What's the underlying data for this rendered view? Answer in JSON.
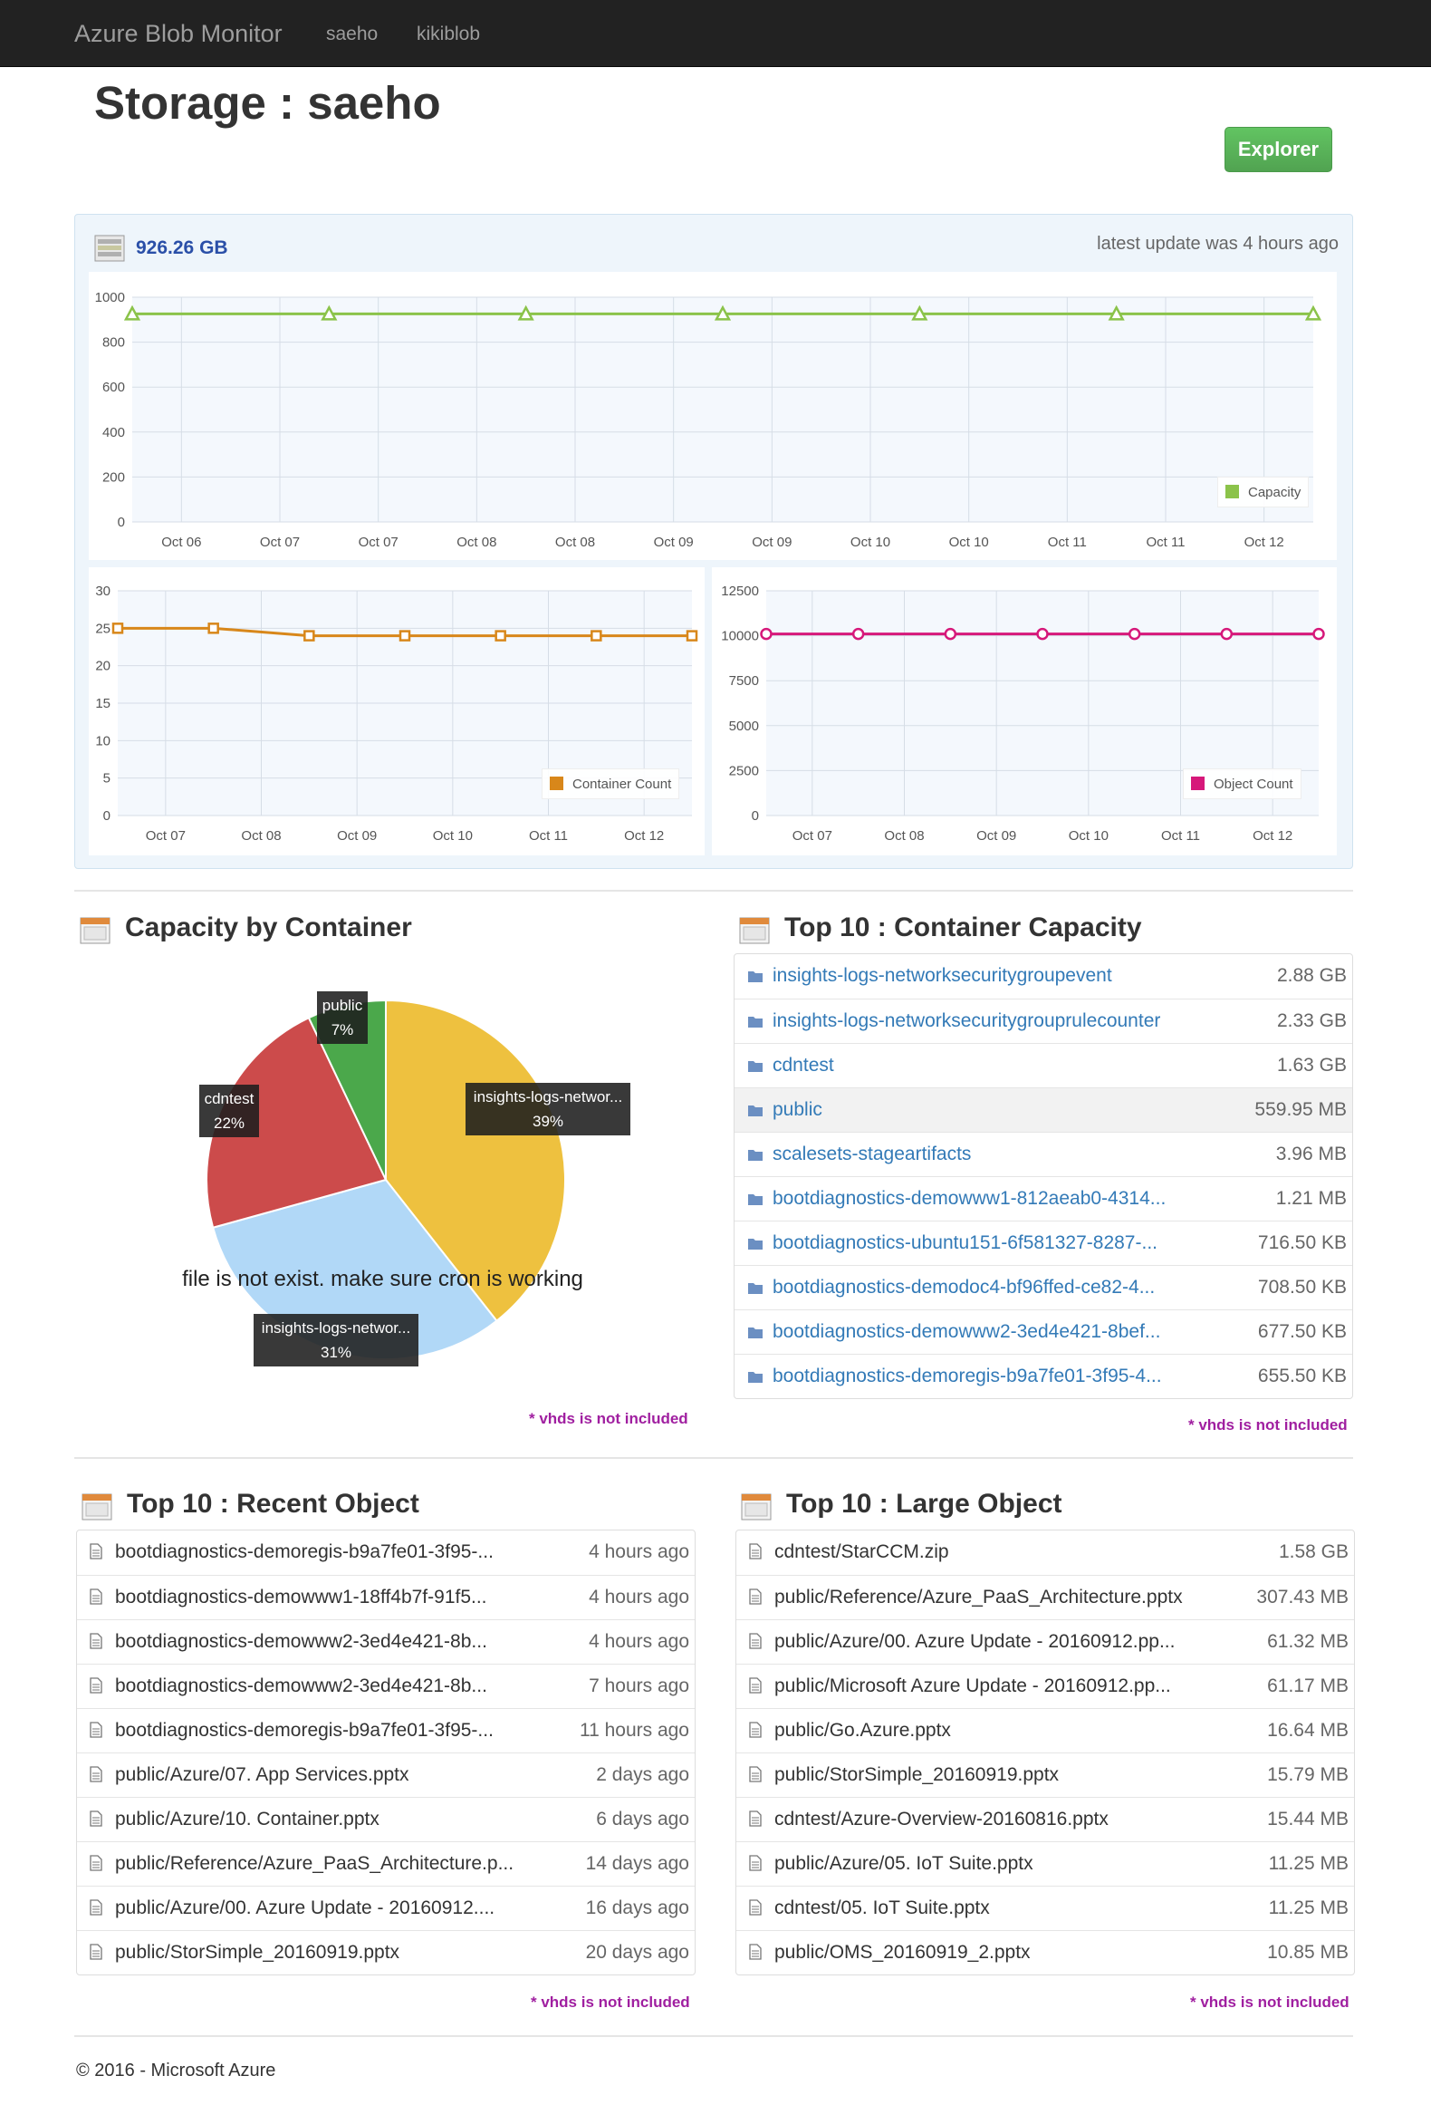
{
  "nav": {
    "brand": "Azure Blob Monitor",
    "links": [
      "saeho",
      "kikiblob"
    ]
  },
  "page": {
    "title": "Storage : saeho",
    "explorer_label": "Explorer"
  },
  "stats": {
    "capacity_value": "926.26 GB",
    "last_update": "latest update was 4 hours ago"
  },
  "colors": {
    "capacity": "#8bc34a",
    "container_count": "#d8871a",
    "object_count": "#d6187a",
    "pie_insights1": "#eec13f",
    "pie_insights2": "#b1d8f7",
    "pie_cdntest": "#cc4b4b",
    "pie_public": "#4ba84b",
    "link": "#337ab7",
    "note": "#a01fa0"
  },
  "chart_data": [
    {
      "type": "line",
      "x": [
        "Oct 06",
        "Oct 07",
        "Oct 07",
        "Oct 08",
        "Oct 08",
        "Oct 09",
        "Oct 09",
        "Oct 10",
        "Oct 10",
        "Oct 11",
        "Oct 11",
        "Oct 12"
      ],
      "series": [
        {
          "name": "Capacity",
          "values": [
            926,
            926,
            926,
            926,
            926,
            926,
            926
          ],
          "marker": "triangle"
        }
      ],
      "yticks": [
        0,
        200,
        400,
        600,
        800,
        1000
      ],
      "ylim": [
        0,
        1000
      ],
      "grid": true,
      "legend": "bottom-right"
    },
    {
      "type": "line",
      "x": [
        "Oct 07",
        "Oct 08",
        "Oct 09",
        "Oct 10",
        "Oct 11",
        "Oct 12"
      ],
      "series": [
        {
          "name": "Container Count",
          "values": [
            25,
            25,
            24,
            24,
            24,
            24,
            24
          ],
          "marker": "square"
        }
      ],
      "yticks": [
        0,
        5,
        10,
        15,
        20,
        25,
        30
      ],
      "ylim": [
        0,
        30
      ],
      "grid": true,
      "legend": "bottom-right"
    },
    {
      "type": "line",
      "x": [
        "Oct 07",
        "Oct 08",
        "Oct 09",
        "Oct 10",
        "Oct 11",
        "Oct 12"
      ],
      "series": [
        {
          "name": "Object Count",
          "values": [
            10100,
            10100,
            10100,
            10100,
            10100,
            10100,
            10100
          ],
          "marker": "circle"
        }
      ],
      "yticks": [
        0,
        2500,
        5000,
        7500,
        10000,
        12500
      ],
      "ylim": [
        0,
        12500
      ],
      "grid": true,
      "legend": "bottom-right"
    },
    {
      "type": "pie",
      "title": "Capacity by Container",
      "slices": [
        {
          "label": "insights-logs-networ...",
          "percent": 39,
          "text": "39%"
        },
        {
          "label": "insights-logs-networ...",
          "percent": 31,
          "text": "31%"
        },
        {
          "label": "cdntest",
          "percent": 22,
          "text": "22%"
        },
        {
          "label": "public",
          "percent": 7,
          "text": "7%"
        }
      ]
    }
  ],
  "pie": {
    "title": "Capacity by Container",
    "message": "file is not exist. make sure cron is working",
    "note": "* vhds is not included"
  },
  "top_capacity": {
    "title": "Top 10 : Container Capacity",
    "note": "* vhds is not included",
    "rows": [
      {
        "name": "insights-logs-networksecuritygroupevent",
        "value": "2.88 GB"
      },
      {
        "name": "insights-logs-networksecuritygrouprulecounter",
        "value": "2.33 GB"
      },
      {
        "name": "cdntest",
        "value": "1.63 GB"
      },
      {
        "name": "public",
        "value": "559.95 MB"
      },
      {
        "name": "scalesets-stageartifacts",
        "value": "3.96 MB"
      },
      {
        "name": "bootdiagnostics-demowww1-812aeab0-4314...",
        "value": "1.21 MB"
      },
      {
        "name": "bootdiagnostics-ubuntu151-6f581327-8287-...",
        "value": "716.50 KB"
      },
      {
        "name": "bootdiagnostics-demodoc4-bf96ffed-ce82-4...",
        "value": "708.50 KB"
      },
      {
        "name": "bootdiagnostics-demowww2-3ed4e421-8bef...",
        "value": "677.50 KB"
      },
      {
        "name": "bootdiagnostics-demoregis-b9a7fe01-3f95-4...",
        "value": "655.50 KB"
      }
    ]
  },
  "top_recent": {
    "title": "Top 10 : Recent Object",
    "note": "* vhds is not included",
    "rows": [
      {
        "name": "bootdiagnostics-demoregis-b9a7fe01-3f95-...",
        "value": "4 hours ago"
      },
      {
        "name": "bootdiagnostics-demowww1-18ff4b7f-91f5...",
        "value": "4 hours ago"
      },
      {
        "name": "bootdiagnostics-demowww2-3ed4e421-8b...",
        "value": "4 hours ago"
      },
      {
        "name": "bootdiagnostics-demowww2-3ed4e421-8b...",
        "value": "7 hours ago"
      },
      {
        "name": "bootdiagnostics-demoregis-b9a7fe01-3f95-...",
        "value": "11 hours ago"
      },
      {
        "name": "public/Azure/07. App Services.pptx",
        "value": "2 days ago"
      },
      {
        "name": "public/Azure/10. Container.pptx",
        "value": "6 days ago"
      },
      {
        "name": "public/Reference/Azure_PaaS_Architecture.p...",
        "value": "14 days ago"
      },
      {
        "name": "public/Azure/00. Azure Update - 20160912....",
        "value": "16 days ago"
      },
      {
        "name": "public/StorSimple_20160919.pptx",
        "value": "20 days ago"
      }
    ]
  },
  "top_large": {
    "title": "Top 10 : Large Object",
    "note": "* vhds is not included",
    "rows": [
      {
        "name": "cdntest/StarCCM.zip",
        "value": "1.58 GB"
      },
      {
        "name": "public/Reference/Azure_PaaS_Architecture.pptx",
        "value": "307.43 MB"
      },
      {
        "name": "public/Azure/00. Azure Update - 20160912.pp...",
        "value": "61.32 MB"
      },
      {
        "name": "public/Microsoft Azure Update - 20160912.pp...",
        "value": "61.17 MB"
      },
      {
        "name": "public/Go.Azure.pptx",
        "value": "16.64 MB"
      },
      {
        "name": "public/StorSimple_20160919.pptx",
        "value": "15.79 MB"
      },
      {
        "name": "cdntest/Azure-Overview-20160816.pptx",
        "value": "15.44 MB"
      },
      {
        "name": "public/Azure/05. IoT Suite.pptx",
        "value": "11.25 MB"
      },
      {
        "name": "cdntest/05. IoT Suite.pptx",
        "value": "11.25 MB"
      },
      {
        "name": "public/OMS_20160919_2.pptx",
        "value": "10.85 MB"
      }
    ]
  },
  "footer": "© 2016 - Microsoft Azure"
}
